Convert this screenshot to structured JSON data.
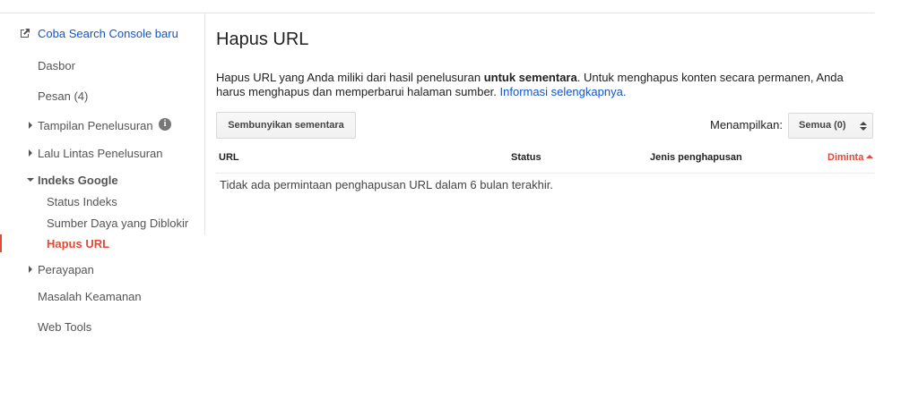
{
  "sidebar": {
    "try_new": "Coba Search Console baru",
    "items": {
      "dasbor": "Dasbor",
      "pesan": "Pesan (4)",
      "tampilan": "Tampilan Penelusuran",
      "lalu_lintas": "Lalu Lintas Penelusuran",
      "indeks": "Indeks Google",
      "status_indeks": "Status Indeks",
      "sumber_daya": "Sumber Daya yang Diblokir",
      "hapus_url": "Hapus URL",
      "perayapan": "Perayapan",
      "keamanan": "Masalah Keamanan",
      "web_tools": "Web Tools"
    },
    "info_glyph": "i"
  },
  "main": {
    "title": "Hapus URL",
    "desc_part1": "Hapus URL yang Anda miliki dari hasil penelusuran ",
    "desc_bold": "untuk sementara",
    "desc_part2": ". Untuk menghapus konten secara permanen, Anda harus menghapus dan memperbarui halaman sumber. ",
    "desc_link": "Informasi selengkapnya.",
    "hide_button": "Sembunyikan sementara",
    "show_label": "Menampilkan:",
    "show_select": "Semua (0)",
    "columns": {
      "url": "URL",
      "status": "Status",
      "jenis": "Jenis penghapusan",
      "diminta": "Diminta"
    },
    "empty_message": "Tidak ada permintaan penghapusan URL dalam 6 bulan terakhir."
  },
  "colors": {
    "link": "#1155cc",
    "active": "#dd4b39",
    "text": "#222222"
  }
}
